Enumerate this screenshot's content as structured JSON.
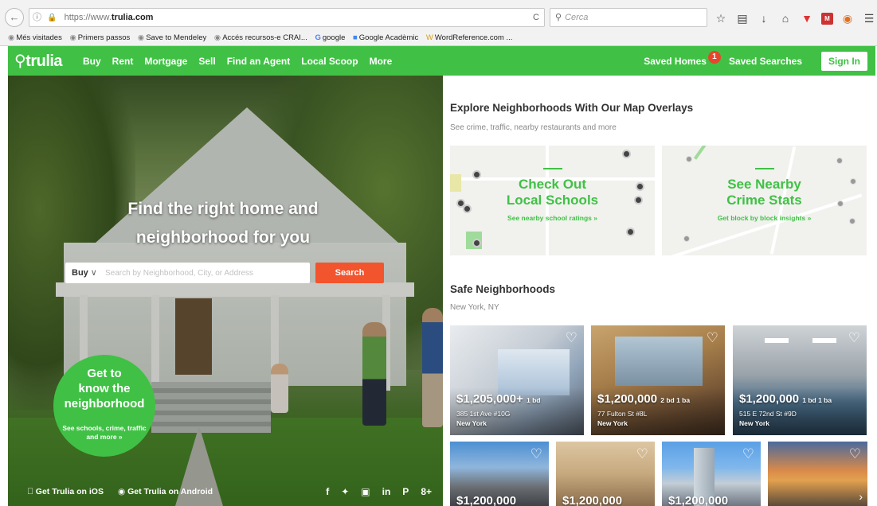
{
  "browser": {
    "url_proto": "https://www.",
    "url_domain": "trulia.com",
    "search_placeholder": "Cerca",
    "bookmarks": [
      "Més visitades",
      "Primers passos",
      "Save to Mendeley",
      "Accés recursos-e CRAI...",
      "google",
      "Google Acadèmic",
      "WordReference.com ..."
    ]
  },
  "header": {
    "logo": "trulia",
    "nav": [
      "Buy",
      "Rent",
      "Mortgage",
      "Sell",
      "Find an Agent",
      "Local Scoop",
      "More"
    ],
    "saved_homes": "Saved Homes",
    "saved_homes_count": "1",
    "saved_searches": "Saved Searches",
    "sign_in": "Sign In"
  },
  "hero": {
    "title_line1": "Find the right home and",
    "title_line2": "neighborhood for you",
    "search_type": "Buy",
    "search_placeholder": "Search by Neighborhood, City, or Address",
    "search_button": "Search",
    "promo_line1": "Get to",
    "promo_line2": "know the",
    "promo_line3": "neighborhood",
    "promo_sub": "See schools, crime, traffic and more »",
    "app_ios": "Get Trulia on iOS",
    "app_android": "Get Trulia on Android"
  },
  "explore": {
    "title": "Explore Neighborhoods With Our Map Overlays",
    "subtitle": "See crime, traffic, nearby restaurants and more",
    "cards": [
      {
        "line1": "Check Out",
        "line2": "Local Schools",
        "link": "See nearby school ratings »"
      },
      {
        "line1": "See Nearby",
        "line2": "Crime Stats",
        "link": "Get block by block insights »"
      }
    ]
  },
  "safe": {
    "title": "Safe Neighborhoods",
    "location": "New York, NY",
    "listings": [
      {
        "price": "$1,205,000+",
        "beds": "1 bd",
        "address": "385 1st Ave #10G",
        "city": "New York"
      },
      {
        "price": "$1,200,000",
        "beds": "2 bd 1 ba",
        "address": "77 Fulton St #8L",
        "city": "New York"
      },
      {
        "price": "$1,200,000",
        "beds": "1 bd 1 ba",
        "address": "515 E 72nd St #9D",
        "city": "New York"
      }
    ],
    "listings_row2": [
      {
        "price": "$1,200,000"
      },
      {
        "price": "$1,200,000"
      },
      {
        "price": "$1,200,000"
      },
      {
        "price": ""
      }
    ]
  },
  "colors": {
    "brand_green": "#40c145",
    "search_orange": "#f2542d",
    "badge_red": "#e8452c"
  }
}
